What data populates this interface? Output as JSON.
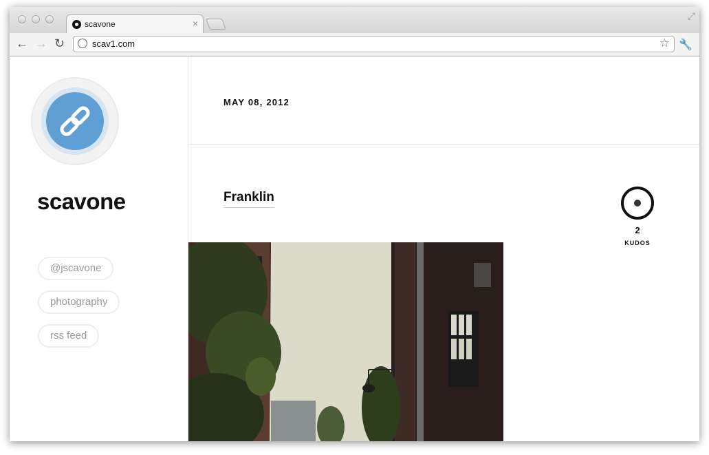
{
  "browser": {
    "tab_title": "scavone",
    "tab_close": "×",
    "url": "scav1.com"
  },
  "sidebar": {
    "blog_title": "scavone",
    "links": [
      {
        "label": "@jscavone"
      },
      {
        "label": "photography"
      },
      {
        "label": "rss feed"
      }
    ]
  },
  "post": {
    "date": "MAY 08, 2012",
    "title": "Franklin",
    "kudos_count": "2",
    "kudos_label": "KUDOS"
  },
  "icons": [
    "back-arrow-icon",
    "forward-arrow-icon",
    "reload-icon",
    "globe-icon",
    "bookmark-star-icon",
    "wrench-icon",
    "chain-link-icon",
    "kudos-icon"
  ],
  "colors": {
    "avatar": "#5f9fd4",
    "avatar_ring": "#d7e4f1",
    "pill_text": "#999999"
  }
}
